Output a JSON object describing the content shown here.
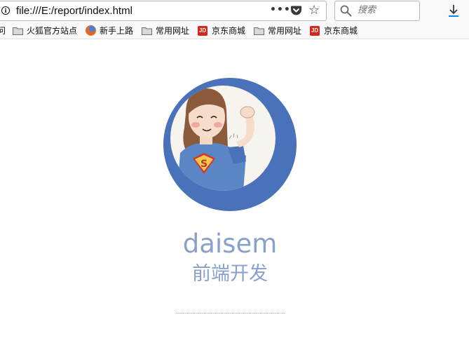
{
  "browser": {
    "url": "file:///E:/report/index.html",
    "page_actions_label": "•••",
    "search_placeholder": "搜索",
    "bookmark_edge_text": "问",
    "bookmarks": [
      {
        "label": "火狐官方站点",
        "icon": "folder-icon"
      },
      {
        "label": "新手上路",
        "icon": "firefox-icon"
      },
      {
        "label": "常用网址",
        "icon": "folder-icon"
      },
      {
        "label": "京东商城",
        "icon": "jd-icon"
      },
      {
        "label": "常用网址",
        "icon": "folder-icon"
      },
      {
        "label": "京东商城",
        "icon": "jd-icon"
      }
    ],
    "jd_icon_text": "JD"
  },
  "profile": {
    "name": "daisem",
    "role": "前端开发",
    "avatar_badge_letter": "S",
    "accent_color": "#4a72ba",
    "text_color": "#8aa0cc"
  }
}
